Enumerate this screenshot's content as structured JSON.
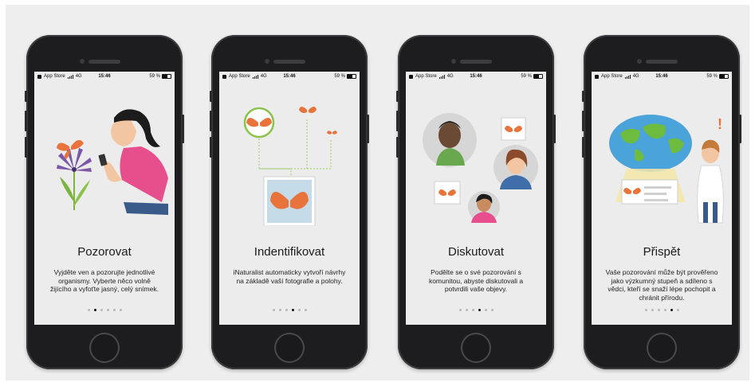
{
  "status_bar": {
    "back_label": "App Store",
    "network": "4G",
    "time": "15:46",
    "battery": "59 %"
  },
  "screens": [
    {
      "title": "Pozorovat",
      "description": "Vyjděte ven a pozorujte jednotlivé organismy. Vyberte něco volně žijícího a vyfoťte jasný, celý snímek.",
      "page_index": 2,
      "page_count": 6
    },
    {
      "title": "Indentifikovat",
      "description": "iNaturalist automaticky vytvoří návrhy na základě vaší fotografie a polohy.",
      "page_index": 4,
      "page_count": 6
    },
    {
      "title": "Diskutovat",
      "description": "Podělte se o své pozorování s komunitou, abyste diskutovali a potvrdili vaše objevy.",
      "page_index": 4,
      "page_count": 6
    },
    {
      "title": "Přispět",
      "description": "Vaše pozorování může být prověřeno jako výzkumný stupeň a sdíleno s vědci, kteří se snaží lépe pochopit a chránit přírodu.",
      "page_index": 5,
      "page_count": 6
    }
  ],
  "colors": {
    "butterfly": "#e8743b",
    "plant": "#7cb342",
    "bg": "#ececec",
    "phone": "#1d1d1f"
  }
}
